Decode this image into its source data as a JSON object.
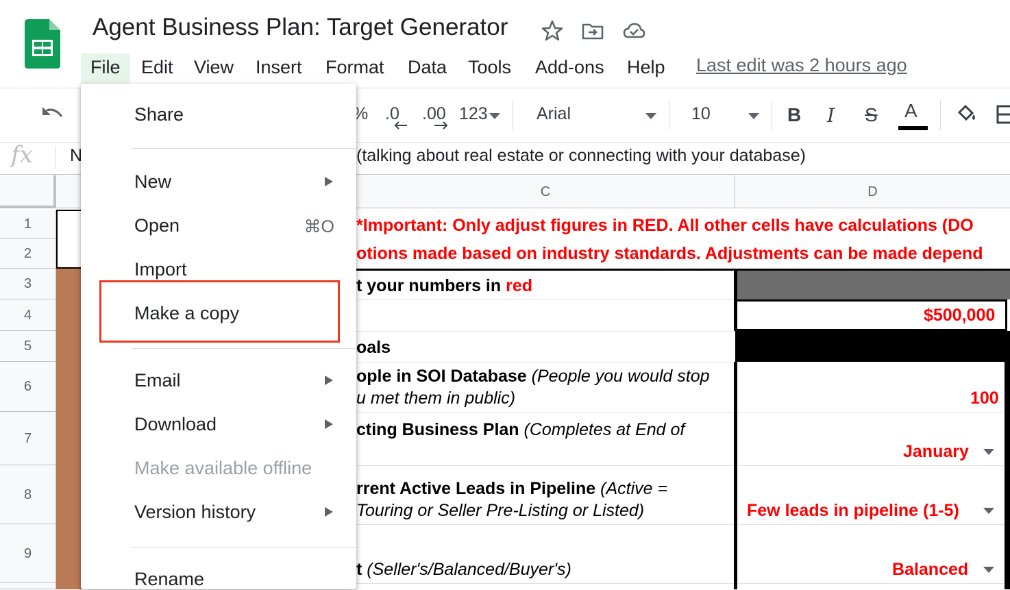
{
  "app": {
    "doc_title": "Agent Business Plan: Target Generator",
    "last_edit": "Last edit was 2 hours ago",
    "brand_color": "#0f9d58"
  },
  "menubar": {
    "file": "File",
    "edit": "Edit",
    "view": "View",
    "insert": "Insert",
    "format": "Format",
    "data": "Data",
    "tools": "Tools",
    "addons": "Add-ons",
    "help": "Help"
  },
  "toolbar": {
    "percent": "%",
    "decrease_decimal": ".0",
    "increase_decimal": ".00",
    "number_format": "123",
    "font": "Arial",
    "font_size": "10",
    "bold": "B",
    "italic": "I",
    "strike": "S",
    "text_color": "A"
  },
  "formula_bar": {
    "fx": "fx",
    "cell_ref": "N",
    "content": "(talking about real estate or connecting with your database)"
  },
  "columns": [
    "C",
    "D"
  ],
  "rows": [
    "1",
    "2",
    "3",
    "4",
    "5",
    "6",
    "7",
    "8",
    "9"
  ],
  "cells": {
    "r1": "*Important: Only adjust figures in RED. All other cells have calculations (DO",
    "r2": "otions made based on industry standards. Adjustments can be made depend",
    "r3_prefix": "t your numbers in ",
    "r3_red": "red",
    "r4_value": "$500,000",
    "r5": "oals",
    "r6_bold": "ople in SOI Database ",
    "r6_ital": "(People you would stop",
    "r6_line2": "u met them in public)",
    "r6_value": "100",
    "r7_bold": "cting Business Plan ",
    "r7_ital": "(Completes at End of",
    "r7_value": "January",
    "r8_bold": "rrent Active Leads in Pipeline ",
    "r8_ital": "(Active =",
    "r8_line2": "Touring or Seller Pre-Listing or Listed)",
    "r8_value": "Few leads in pipeline (1-5)",
    "r9_bold": "t ",
    "r9_ital": "(Seller's/Balanced/Buyer's)",
    "r9_value": "Balanced"
  },
  "file_menu": {
    "share": "Share",
    "new": "New",
    "open": "Open",
    "open_shortcut": "⌘O",
    "import": "Import",
    "make_copy": "Make a copy",
    "email": "Email",
    "download": "Download",
    "offline": "Make available offline",
    "version_history": "Version history",
    "rename": "Rename"
  },
  "colors": {
    "highlight": "#ee3a1f",
    "red_text": "#ff0000",
    "file_active_bg": "#e6f4ea"
  }
}
